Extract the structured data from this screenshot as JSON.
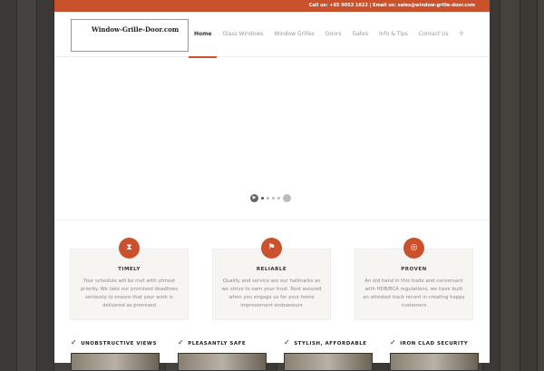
{
  "topbar": {
    "contact": "Call us: +65 9053 1822 | Email us: sales@window-grille-door.com"
  },
  "logo": {
    "text": "Window-Grille-Door.com"
  },
  "nav": [
    "Home",
    "Glass Windows",
    "Window Grilles",
    "Doors",
    "Gates",
    "Info & Tips",
    "Contact Us"
  ],
  "features": [
    {
      "title": "TIMELY",
      "icon": "hourglass-icon",
      "text": "Your schedule will be met with utmost priority. We take our promised deadlines seriously to ensure that your work is delivered as promised"
    },
    {
      "title": "RELIABLE",
      "icon": "flag-icon",
      "text": "Quality and service are our hallmarks as we strive to earn your trust. Rest assured when you engage us for your home improvement endeavours"
    },
    {
      "title": "PROVEN",
      "icon": "globe-icon",
      "text": "An old hand in this trade and conversant with HDB/BCA regulations, we have built an attested track record in creating happy customers"
    }
  ],
  "highlights": [
    "UNOBSTRUCTIVE VIEWS",
    "PLEASANTLY SAFE",
    "STYLISH, AFFORDABLE",
    "IRON CLAD SECURITY"
  ],
  "colors": {
    "accent": "#c9522d"
  }
}
